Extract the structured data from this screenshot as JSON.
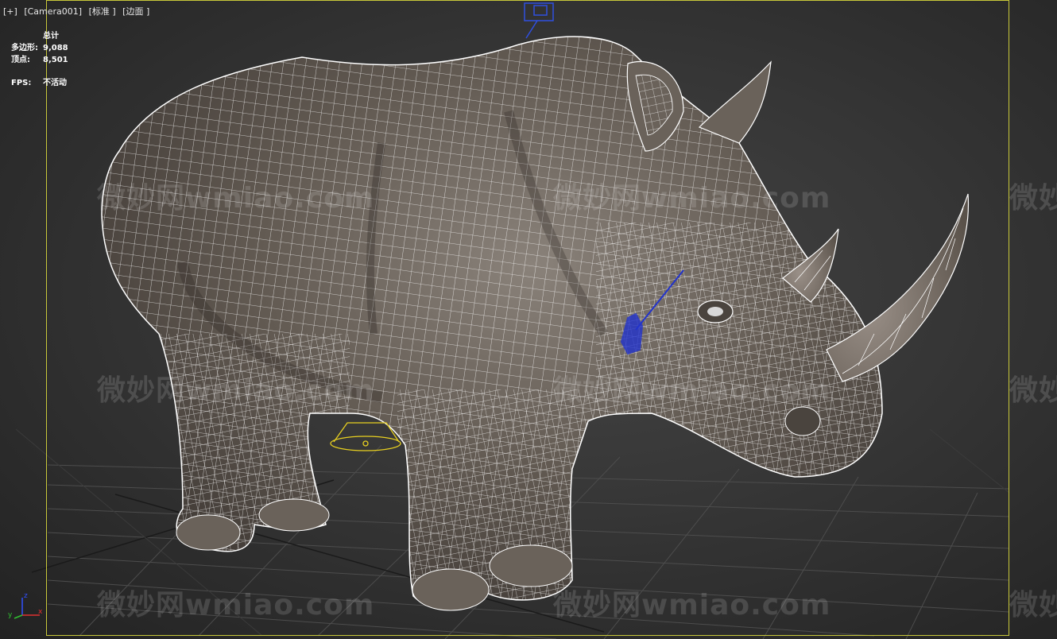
{
  "viewport": {
    "labels": [
      "[+]",
      "[Camera001]",
      "[标准 ]",
      "[边面 ]"
    ]
  },
  "stats": {
    "header": "总计",
    "polygons_label": "多边形:",
    "polygons_value": "9,088",
    "vertices_label": "顶点:",
    "vertices_value": "8,501",
    "fps_label": "FPS:",
    "fps_value": "不活动"
  },
  "watermark": {
    "text": "微妙网wmiao.com",
    "partial": "微妙"
  },
  "axis": {
    "x": "x",
    "y": "y",
    "z": "z"
  },
  "colors": {
    "safe_frame": "#c8c83a",
    "wire": "#ffffff",
    "rhino_skin": "#625a52",
    "grid": "#4c4c4c",
    "light_helper": "#2233cc",
    "light_yellow": "#e8d020"
  }
}
